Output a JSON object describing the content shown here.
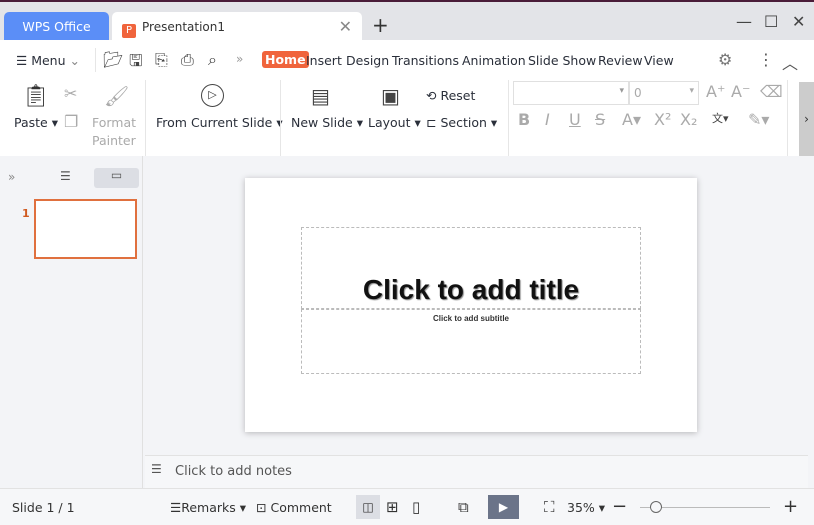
{
  "titlebar": {
    "home_tab": "WPS Office",
    "doc_tab": "Presentation1",
    "new_tab": "+"
  },
  "menu": {
    "menu_label": "Menu",
    "tabs": [
      "Home",
      "Insert",
      "Design",
      "Transitions",
      "Animation",
      "Slide Show",
      "Review",
      "View"
    ],
    "active_tab": "Home"
  },
  "ribbon": {
    "paste": "Paste",
    "format_painter_1": "Format",
    "format_painter_2": "Painter",
    "from_current_slide": "From Current Slide",
    "new_slide": "New Slide",
    "layout": "Layout",
    "reset": "Reset",
    "section": "Section",
    "font_name": "",
    "font_size": "0"
  },
  "panel": {
    "slide_number": "1"
  },
  "slide": {
    "title_placeholder": "Click to add title",
    "subtitle_placeholder": "Click to add subtitle"
  },
  "notes": {
    "placeholder": "Click to add notes"
  },
  "status": {
    "slide_indicator": "Slide 1 / 1",
    "remarks": "Remarks",
    "comment": "Comment",
    "zoom": "35%",
    "zoom_level_percent": 35
  },
  "colors": {
    "accent": "#f0643c",
    "wps_tab": "#5b8ef7"
  }
}
